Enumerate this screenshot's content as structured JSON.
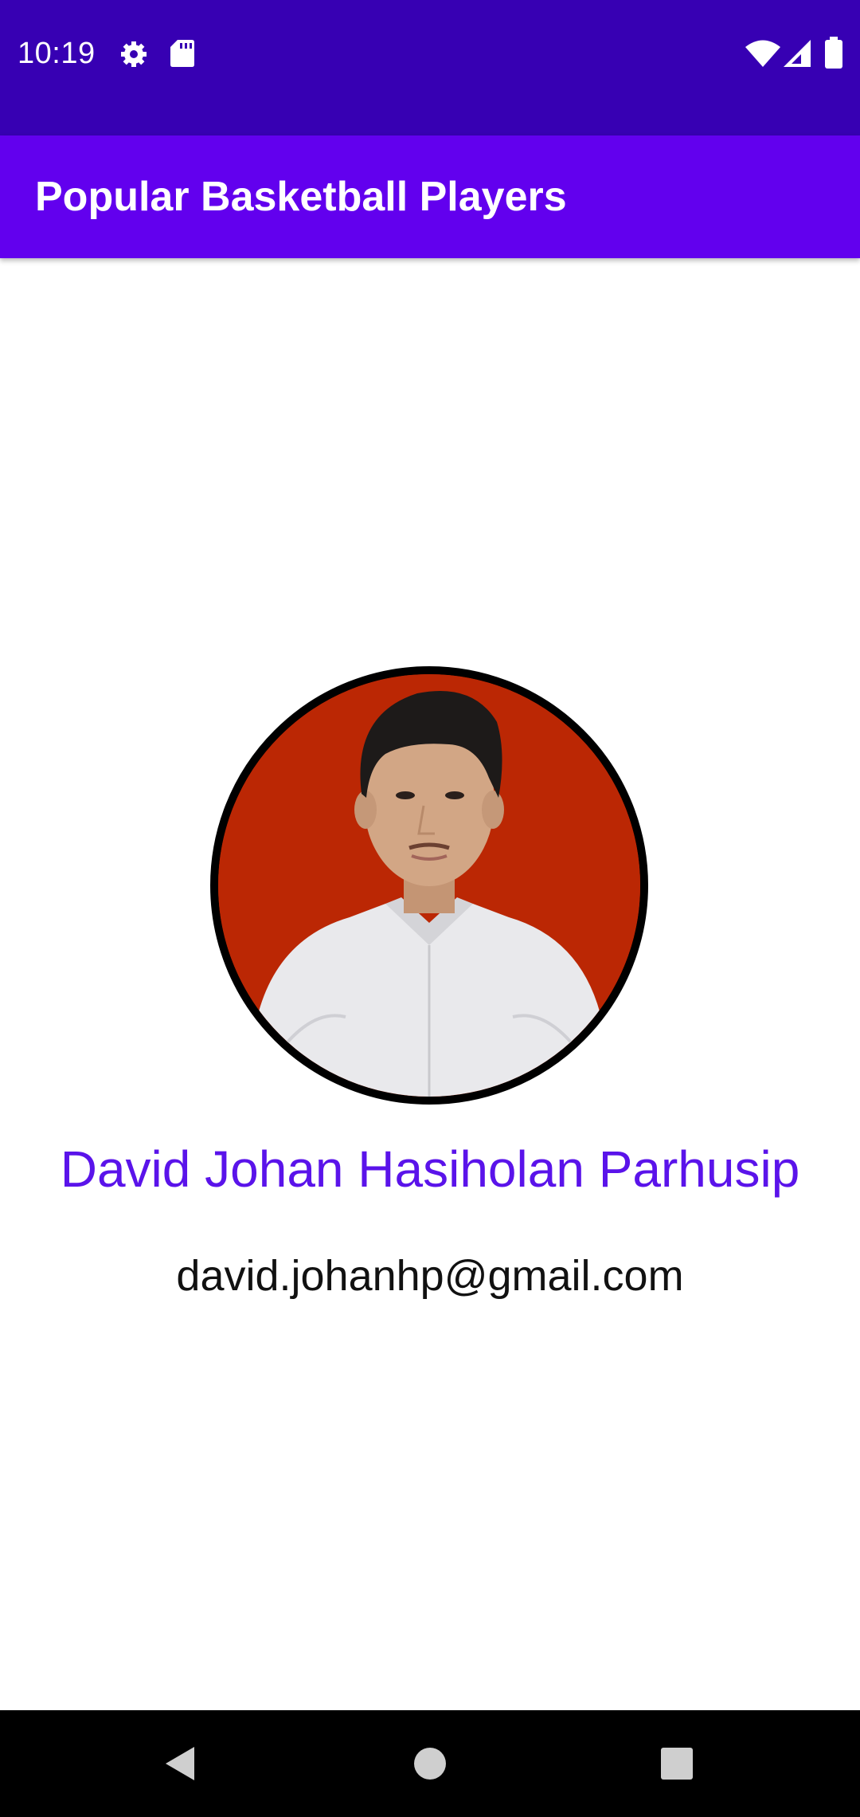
{
  "status_bar": {
    "time": "10:19",
    "icons": [
      "settings-icon",
      "sd-card-icon",
      "wifi-icon",
      "signal-icon",
      "battery-icon"
    ]
  },
  "app_bar": {
    "title": "Popular Basketball Players"
  },
  "profile": {
    "photo": "profile-photo",
    "name": "David Johan Hasiholan Parhusip",
    "email": "david.johanhp@gmail.com"
  },
  "navigation": {
    "buttons": [
      "back-icon",
      "home-icon",
      "recents-icon"
    ]
  },
  "colors": {
    "status_bar": "#3700b3",
    "app_bar": "#6200ee",
    "name_text": "#5a13ea",
    "photo_background": "#bb2704"
  }
}
